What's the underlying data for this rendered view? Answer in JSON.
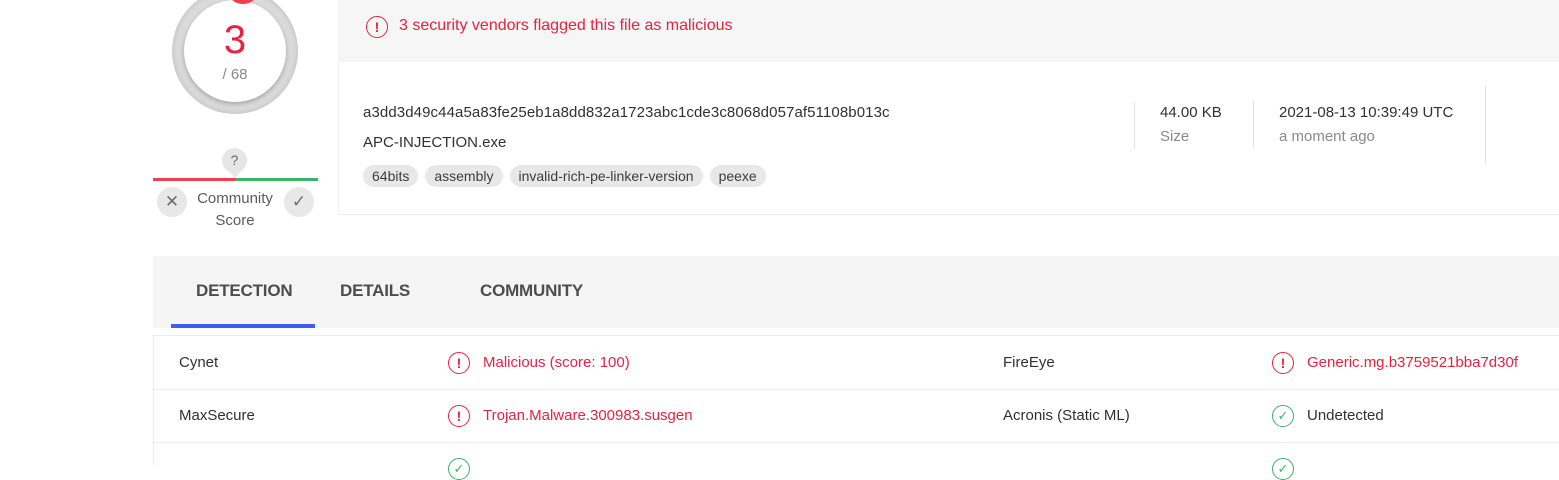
{
  "score": {
    "detections": "3",
    "total": "/ 68"
  },
  "community": {
    "question_mark": "?",
    "label_line1": "Community",
    "label_line2": "Score",
    "downvote_glyph": "✕",
    "upvote_glyph": "✓"
  },
  "alert": {
    "icon_glyph": "!",
    "text": "3 security vendors flagged this file as malicious"
  },
  "file": {
    "hash": "a3dd3d49c44a5a83fe25eb1a8dd832a1723abc1cde3c8068d057af51108b013c",
    "name": "APC-INJECTION.exe",
    "tags": [
      "64bits",
      "assembly",
      "invalid-rich-pe-linker-version",
      "peexe"
    ],
    "size_value": "44.00 KB",
    "size_label": "Size",
    "date_value": "2021-08-13 10:39:49 UTC",
    "date_label": "a moment ago"
  },
  "tabs": [
    "DETECTION",
    "DETAILS",
    "COMMUNITY"
  ],
  "detections": [
    {
      "vendor_left": "Cynet",
      "result_left": "Malicious (score: 100)",
      "status_left": "malicious",
      "vendor_right": "FireEye",
      "result_right": "Generic.mg.b3759521bba7d30f",
      "status_right": "malicious"
    },
    {
      "vendor_left": "MaxSecure",
      "result_left": "Trojan.Malware.300983.susgen",
      "status_left": "malicious",
      "vendor_right": "Acronis (Static ML)",
      "result_right": "Undetected",
      "status_right": "undetected"
    }
  ],
  "icons": {
    "malicious": "alert-circle-icon",
    "undetected": "check-circle-icon"
  },
  "colors": {
    "malicious": "#e62342",
    "undetected": "#3cb26a",
    "tab_active": "#3f5cf0"
  }
}
